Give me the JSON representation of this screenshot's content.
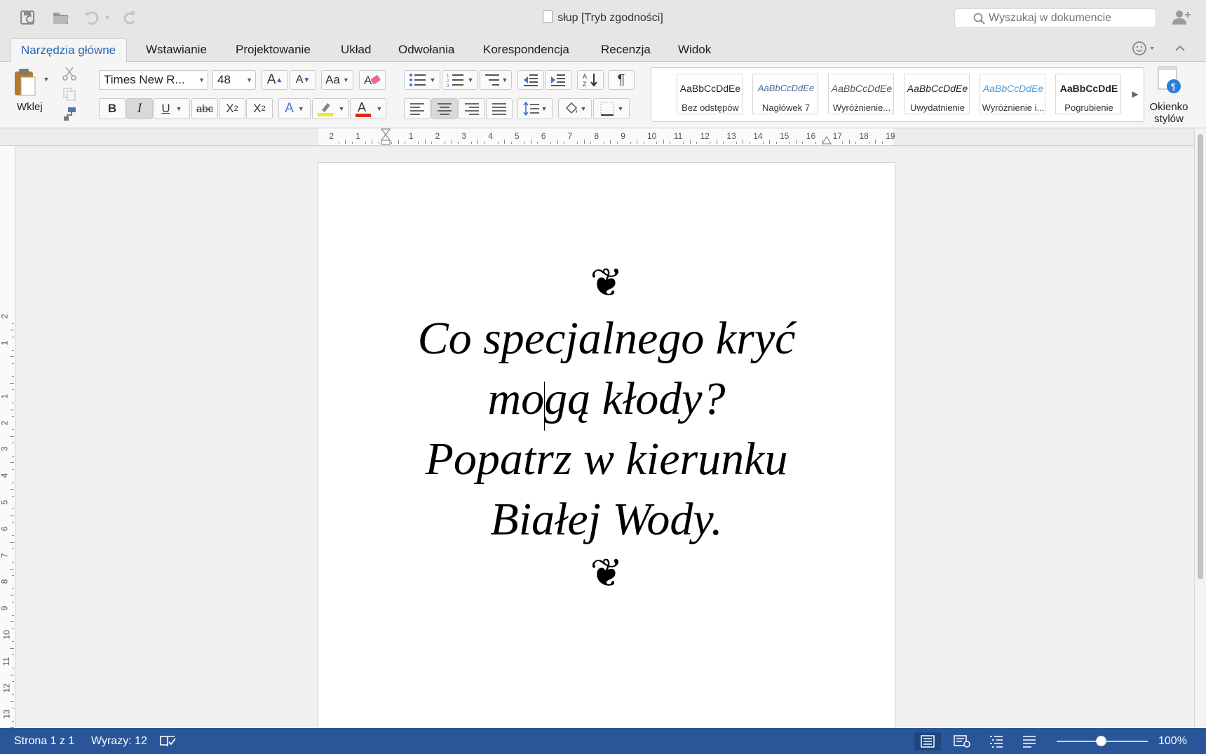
{
  "window": {
    "title": "słup [Tryb zgodności]",
    "search_placeholder": "Wyszukaj w dokumencie"
  },
  "tabs": [
    {
      "label": "Narzędzia główne",
      "active": true
    },
    {
      "label": "Wstawianie"
    },
    {
      "label": "Projektowanie"
    },
    {
      "label": "Układ"
    },
    {
      "label": "Odwołania"
    },
    {
      "label": "Korespondencja"
    },
    {
      "label": "Recenzja"
    },
    {
      "label": "Widok"
    }
  ],
  "ribbon": {
    "paste_label": "Wklej",
    "font_name": "Times New R...",
    "font_size": "48",
    "styles": [
      {
        "sample": "AaBbCcDdEe",
        "name": "Bez odstępów"
      },
      {
        "sample": "AaBbCcDdEe",
        "name": "Nagłówek 7"
      },
      {
        "sample": "AaBbCcDdEe",
        "name": "Wyróżnienie..."
      },
      {
        "sample": "AaBbCcDdEe",
        "name": "Uwydatnienie"
      },
      {
        "sample": "AaBbCcDdEe",
        "name": "Wyróżnienie i..."
      },
      {
        "sample": "AaBbCcDdE",
        "name": "Pogrubienie"
      }
    ],
    "styles_pane_label_line1": "Okienko",
    "styles_pane_label_line2": "stylów",
    "accent_color": "#2a66b7"
  },
  "document": {
    "fleuron": "❦",
    "lines": [
      "Co specjalnego kryć",
      "mogą kłody?",
      "Popatrz w kierunku",
      "Białej Wody."
    ]
  },
  "status": {
    "page": "Strona 1 z 1",
    "words": "Wyrazy: 12",
    "zoom": "100%",
    "bar_color": "#2a5699"
  }
}
